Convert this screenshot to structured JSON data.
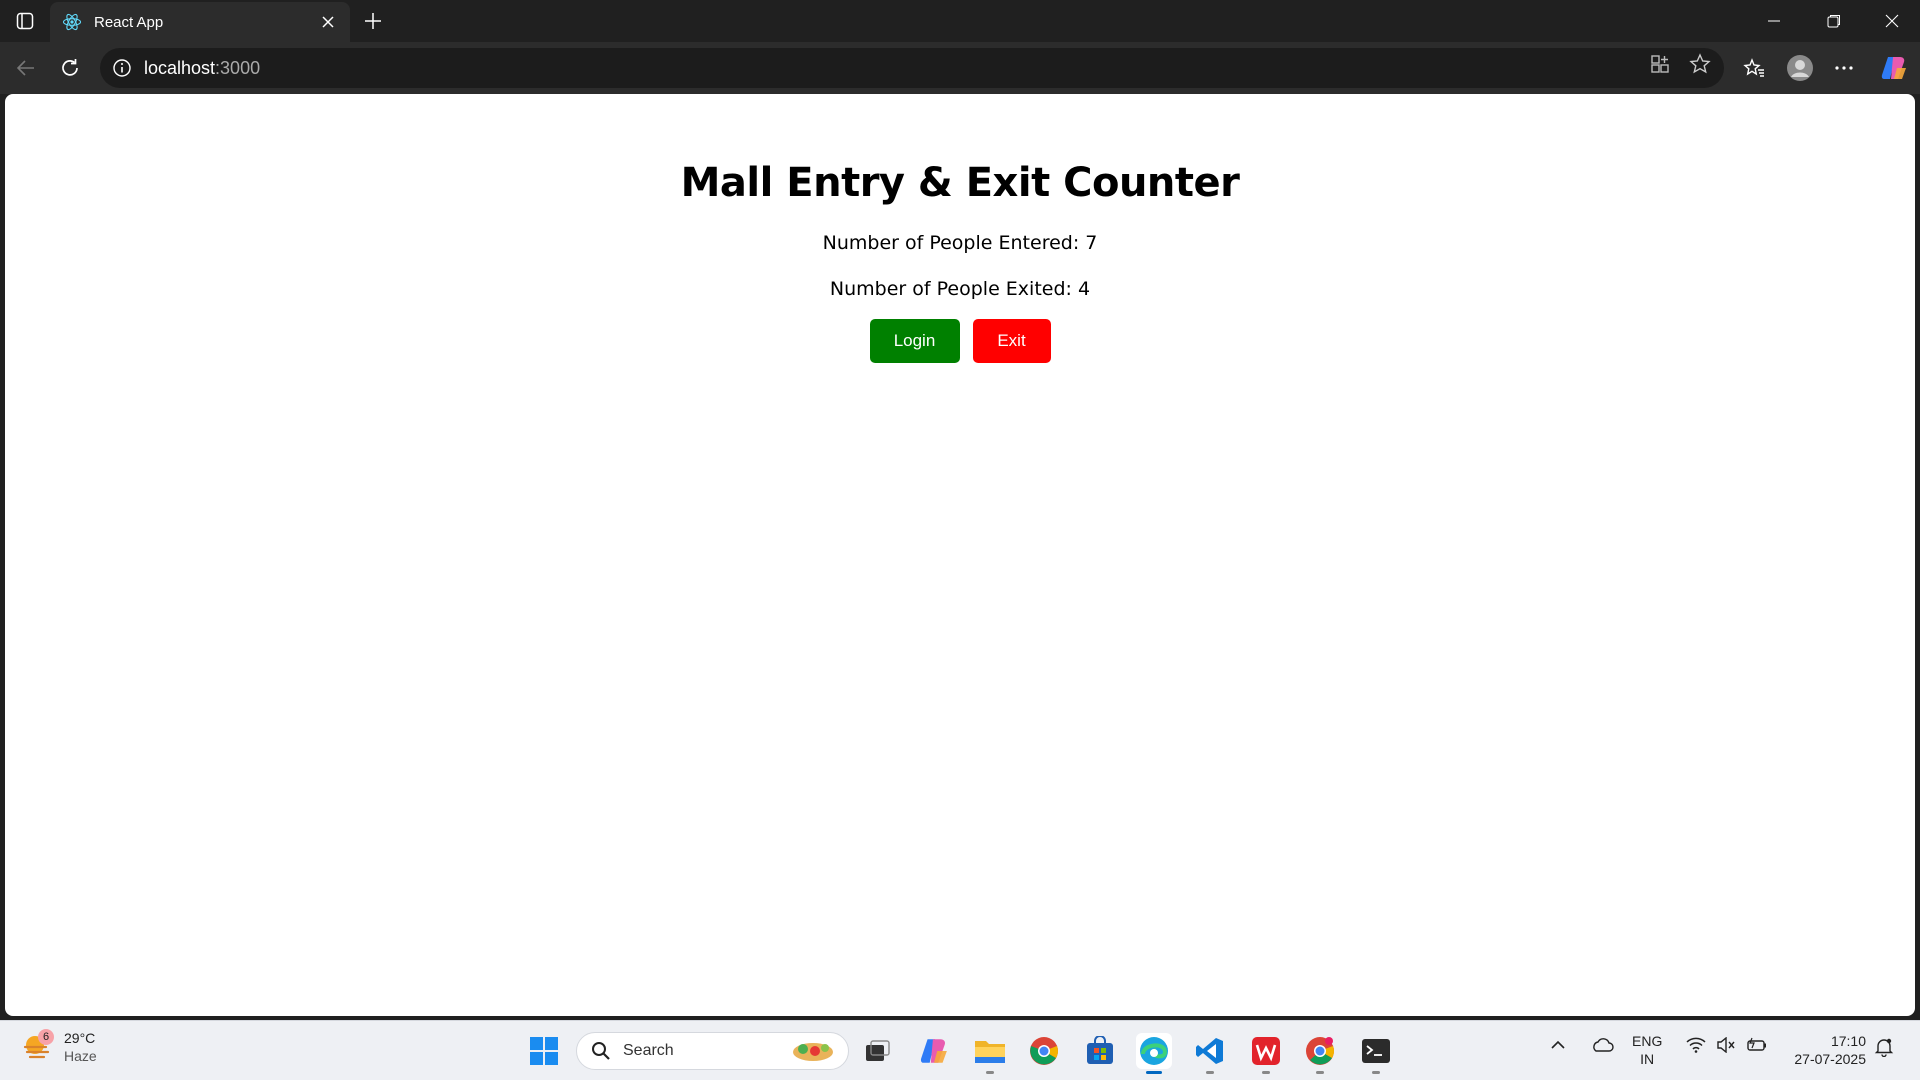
{
  "browser": {
    "tab": {
      "title": "React App"
    },
    "address": {
      "host": "localhost",
      "port": ":3000"
    }
  },
  "app": {
    "heading": "Mall Entry & Exit Counter",
    "entered_text": "Number of People Entered: 7",
    "exited_text": "Number of People Exited: 4",
    "login_label": "Login",
    "exit_label": "Exit",
    "login_color": "#008000",
    "exit_color": "#ff0000"
  },
  "taskbar": {
    "weather": {
      "badge": "6",
      "temp": "29°C",
      "condition": "Haze"
    },
    "search_placeholder": "Search",
    "language": {
      "line1": "ENG",
      "line2": "IN"
    },
    "clock": {
      "time": "17:10",
      "date": "27-07-2025"
    }
  }
}
